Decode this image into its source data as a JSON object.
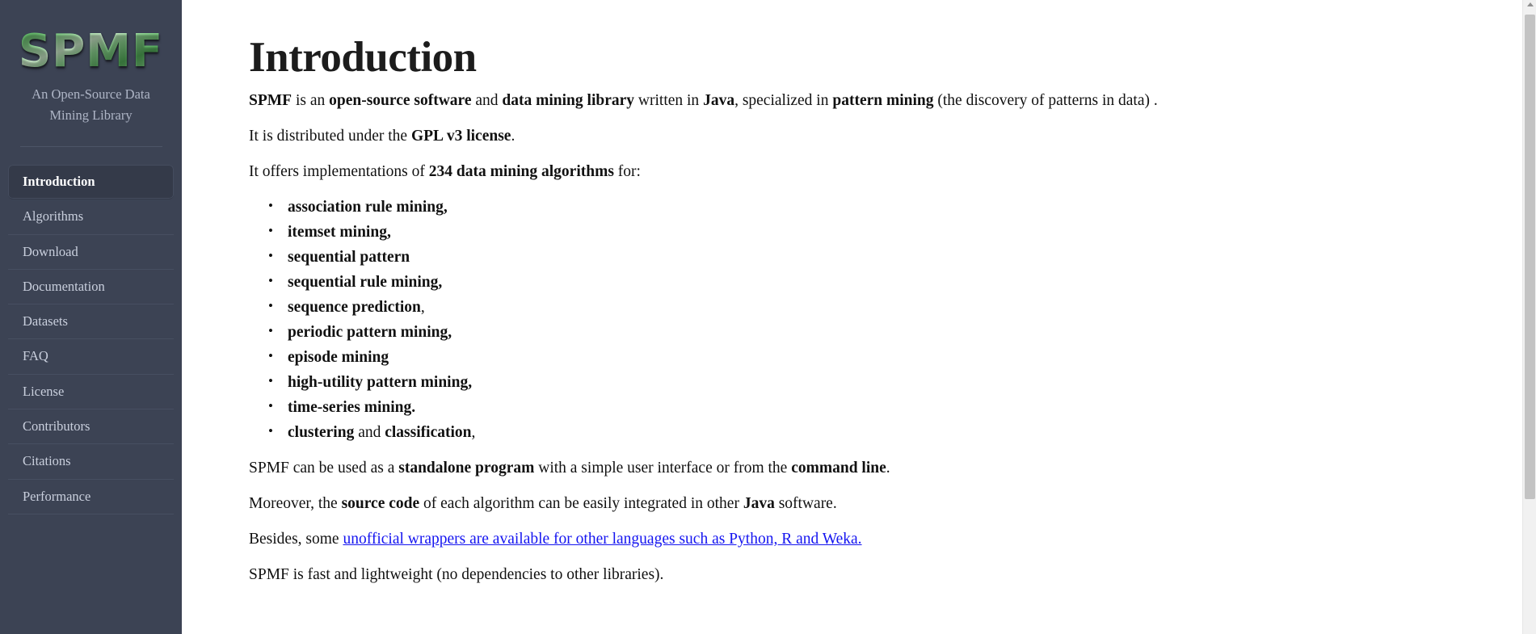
{
  "sidebar": {
    "logo_text": "SPMF",
    "tagline": "An Open-Source Data Mining Library",
    "nav_items": [
      {
        "label": "Introduction",
        "active": true
      },
      {
        "label": "Algorithms",
        "active": false
      },
      {
        "label": "Download",
        "active": false
      },
      {
        "label": "Documentation",
        "active": false
      },
      {
        "label": "Datasets",
        "active": false
      },
      {
        "label": "FAQ",
        "active": false
      },
      {
        "label": "License",
        "active": false
      },
      {
        "label": "Contributors",
        "active": false
      },
      {
        "label": "Citations",
        "active": false
      },
      {
        "label": "Performance",
        "active": false
      }
    ],
    "bg_color": "#3c4354",
    "active_bg_color": "#343a49"
  },
  "main": {
    "title": "Introduction",
    "p1": {
      "s1": "SPMF",
      "s2": " is an ",
      "s3": "open-source software",
      "s4": " and ",
      "s5": "data mining library",
      "s6": " written in ",
      "s7": "Java",
      "s8": ", specialized in ",
      "s9": "pattern mining",
      "s10": " (the discovery of patterns in data) ."
    },
    "p2": {
      "s1": "It is distributed under the ",
      "s2": "GPL v3 license",
      "s3": "."
    },
    "p3": {
      "s1": "It offers implementations of ",
      "s2": "234 data mining algorithms",
      "s3": " for:"
    },
    "features": [
      {
        "bold": "association rule mining,",
        "plain": ""
      },
      {
        "bold": "itemset mining,",
        "plain": ""
      },
      {
        "bold": "sequential pattern",
        "plain": ""
      },
      {
        "bold": "sequential rule mining,",
        "plain": ""
      },
      {
        "bold": "sequence prediction",
        "plain": ","
      },
      {
        "bold": "periodic pattern mining,",
        "plain": ""
      },
      {
        "bold": "episode mining",
        "plain": ""
      },
      {
        "bold": "high-utility pattern mining,",
        "plain": ""
      },
      {
        "bold": "time-series mining.",
        "plain": ""
      },
      {
        "bold": "clustering",
        "mid": " and ",
        "bold2": "classification",
        "plain": ","
      }
    ],
    "p4": {
      "s1": "SPMF can be used as a ",
      "s2": "standalone program",
      "s3": " with a simple user interface or from the ",
      "s4": "command line",
      "s5": "."
    },
    "p5": {
      "s1": "Moreover, the ",
      "s2": "source code",
      "s3": " of each algorithm can be easily integrated in other ",
      "s4": "Java",
      "s5": " software."
    },
    "p6": {
      "s1": "Besides, some ",
      "link": "unofficial wrappers are available for other languages such as Python, R and Weka.",
      "link_color": "#1414f0"
    },
    "p7": {
      "s1": "SPMF is fast and lightweight (no dependencies to other libraries)."
    }
  },
  "scrollbar": {
    "track_color": "#f1f1f1",
    "thumb_color": "#c3c3c3"
  }
}
